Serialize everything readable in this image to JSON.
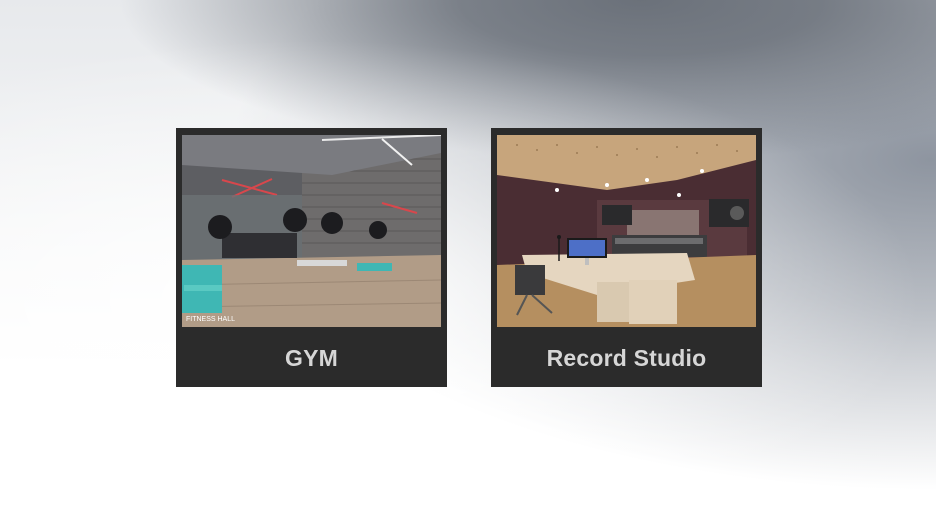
{
  "cards": [
    {
      "label": "GYM",
      "thumb_icon": "gym-room-image",
      "watermark": "FITNESS HALL"
    },
    {
      "label": "Record Studio",
      "thumb_icon": "recording-studio-image"
    }
  ],
  "colors": {
    "card_bg": "#2b2b2b",
    "label_text": "#d6d6d6"
  }
}
